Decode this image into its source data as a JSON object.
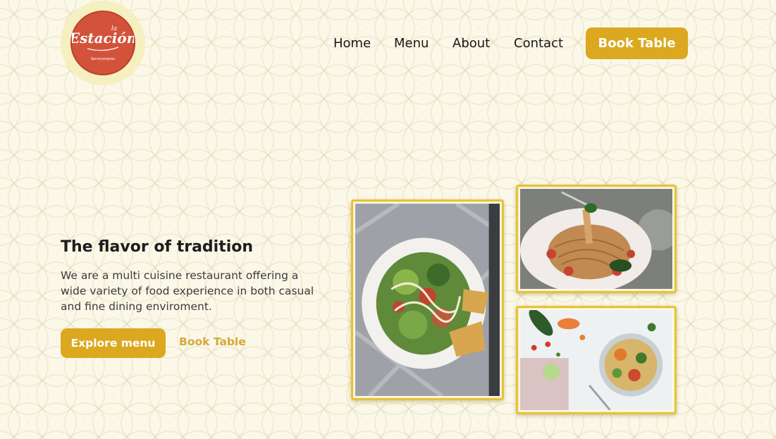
{
  "brand": {
    "logo_script": "Estación",
    "logo_small": "la",
    "logo_subtitle": "Servicompras",
    "logo_color": "#d2533a"
  },
  "nav": {
    "items": [
      {
        "label": "Home"
      },
      {
        "label": "Menu"
      },
      {
        "label": "About"
      },
      {
        "label": "Contact"
      }
    ],
    "cta_label": "Book Table"
  },
  "hero": {
    "title": "The flavor of tradition",
    "description": "We are a multi cuisine restaurant offering a wide variety of food experience in both casual and fine dining enviroment.",
    "primary_button": "Explore menu",
    "secondary_link": "Book Table"
  },
  "gallery": [
    {
      "name": "salad-photo",
      "subject": "caesar salad on a plate"
    },
    {
      "name": "pasta-photo",
      "subject": "spaghetti twirled on a fork"
    },
    {
      "name": "bowl-photo",
      "subject": "vegetable quinoa bowl with fresh ingredients"
    }
  ],
  "colors": {
    "accent": "#dba81f",
    "background": "#fbf8e9",
    "link_accent": "#d4a93a",
    "frame_gold": "#e6c23a"
  }
}
